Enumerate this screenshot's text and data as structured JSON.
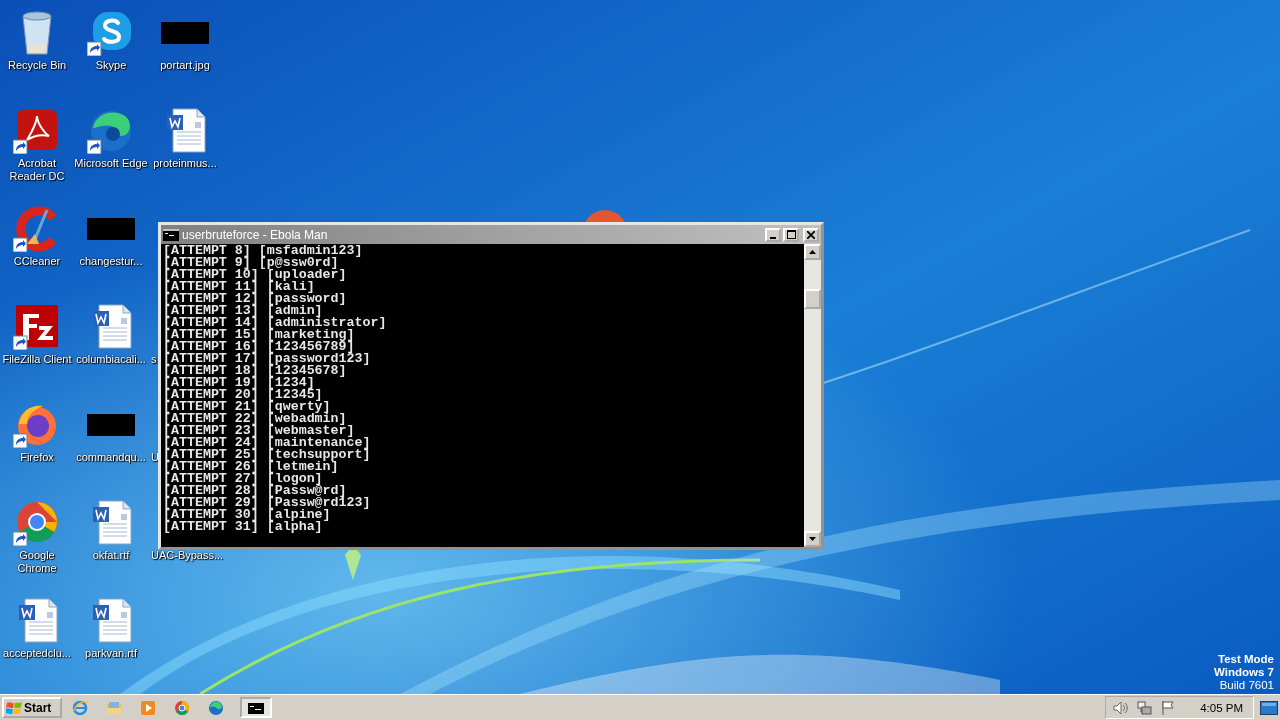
{
  "desktop": {
    "icons": [
      {
        "label": "Recycle Bin",
        "kind": "recycle",
        "shortcut": false
      },
      {
        "label": "Acrobat Reader DC",
        "kind": "acrobat",
        "shortcut": true
      },
      {
        "label": "CCleaner",
        "kind": "ccleaner",
        "shortcut": true
      },
      {
        "label": "FileZilla Client",
        "kind": "filezilla",
        "shortcut": true
      },
      {
        "label": "Firefox",
        "kind": "firefox",
        "shortcut": true
      },
      {
        "label": "Google Chrome",
        "kind": "chrome",
        "shortcut": true
      },
      {
        "label": "acceptedclu...",
        "kind": "word",
        "shortcut": false
      },
      {
        "label": "Skype",
        "kind": "skype",
        "shortcut": true
      },
      {
        "label": "Microsoft Edge",
        "kind": "edge",
        "shortcut": true
      },
      {
        "label": "changestur...",
        "kind": "blacked",
        "shortcut": false
      },
      {
        "label": "columbiacali...",
        "kind": "word",
        "shortcut": false
      },
      {
        "label": "commandqu...",
        "kind": "blacked",
        "shortcut": false
      },
      {
        "label": "okfat.rtf",
        "kind": "word",
        "shortcut": false
      },
      {
        "label": "parkvan.rtf",
        "kind": "word",
        "shortcut": false
      },
      {
        "label": "portart.jpg",
        "kind": "blacked",
        "shortcut": false
      },
      {
        "label": "proteinmus...",
        "kind": "word",
        "shortcut": false
      },
      {
        "kind": "covered"
      },
      {
        "label": "s",
        "kind": "covered"
      },
      {
        "label": "U",
        "kind": "covered"
      },
      {
        "label": "UAC-Bypass...",
        "kind": "covered"
      }
    ],
    "os_notice": [
      {
        "text": "Test Mode",
        "bold": true
      },
      {
        "text": "Windows 7",
        "bold": true
      },
      {
        "text": "Build 7601",
        "bold": false
      }
    ]
  },
  "console": {
    "title": "userbruteforce - Ebola Man",
    "lines": [
      "[ATTEMPT 8] [msfadmin123]",
      "[ATTEMPT 9] [p@ssw0rd]",
      "[ATTEMPT 10] [uploader]",
      "[ATTEMPT 11] [kali]",
      "[ATTEMPT 12] [password]",
      "[ATTEMPT 13] [admin]",
      "[ATTEMPT 14] [administrator]",
      "[ATTEMPT 15] [marketing]",
      "[ATTEMPT 16] [123456789]",
      "[ATTEMPT 17] [password123]",
      "[ATTEMPT 18] [12345678]",
      "[ATTEMPT 19] [1234]",
      "[ATTEMPT 20] [12345]",
      "[ATTEMPT 21] [qwerty]",
      "[ATTEMPT 22] [webadmin]",
      "[ATTEMPT 23] [webmaster]",
      "[ATTEMPT 24] [maintenance]",
      "[ATTEMPT 25] [techsupport]",
      "[ATTEMPT 26] [letmein]",
      "[ATTEMPT 27] [logon]",
      "[ATTEMPT 28] [Passw@rd]",
      "[ATTEMPT 29] [Passw@rd123]",
      "[ATTEMPT 30] [alpine]",
      "[ATTEMPT 31] [alpha]"
    ]
  },
  "taskbar": {
    "start": "Start",
    "pinned": [
      {
        "kind": "ie"
      },
      {
        "kind": "explorer"
      },
      {
        "kind": "media"
      },
      {
        "kind": "chrome"
      },
      {
        "kind": "edge"
      }
    ],
    "tasks": [
      {
        "kind": "console",
        "selected": true
      }
    ],
    "tray": {
      "icons": [
        {
          "kind": "volume"
        },
        {
          "kind": "network"
        },
        {
          "kind": "flag"
        }
      ],
      "time": "4:05 PM"
    }
  }
}
